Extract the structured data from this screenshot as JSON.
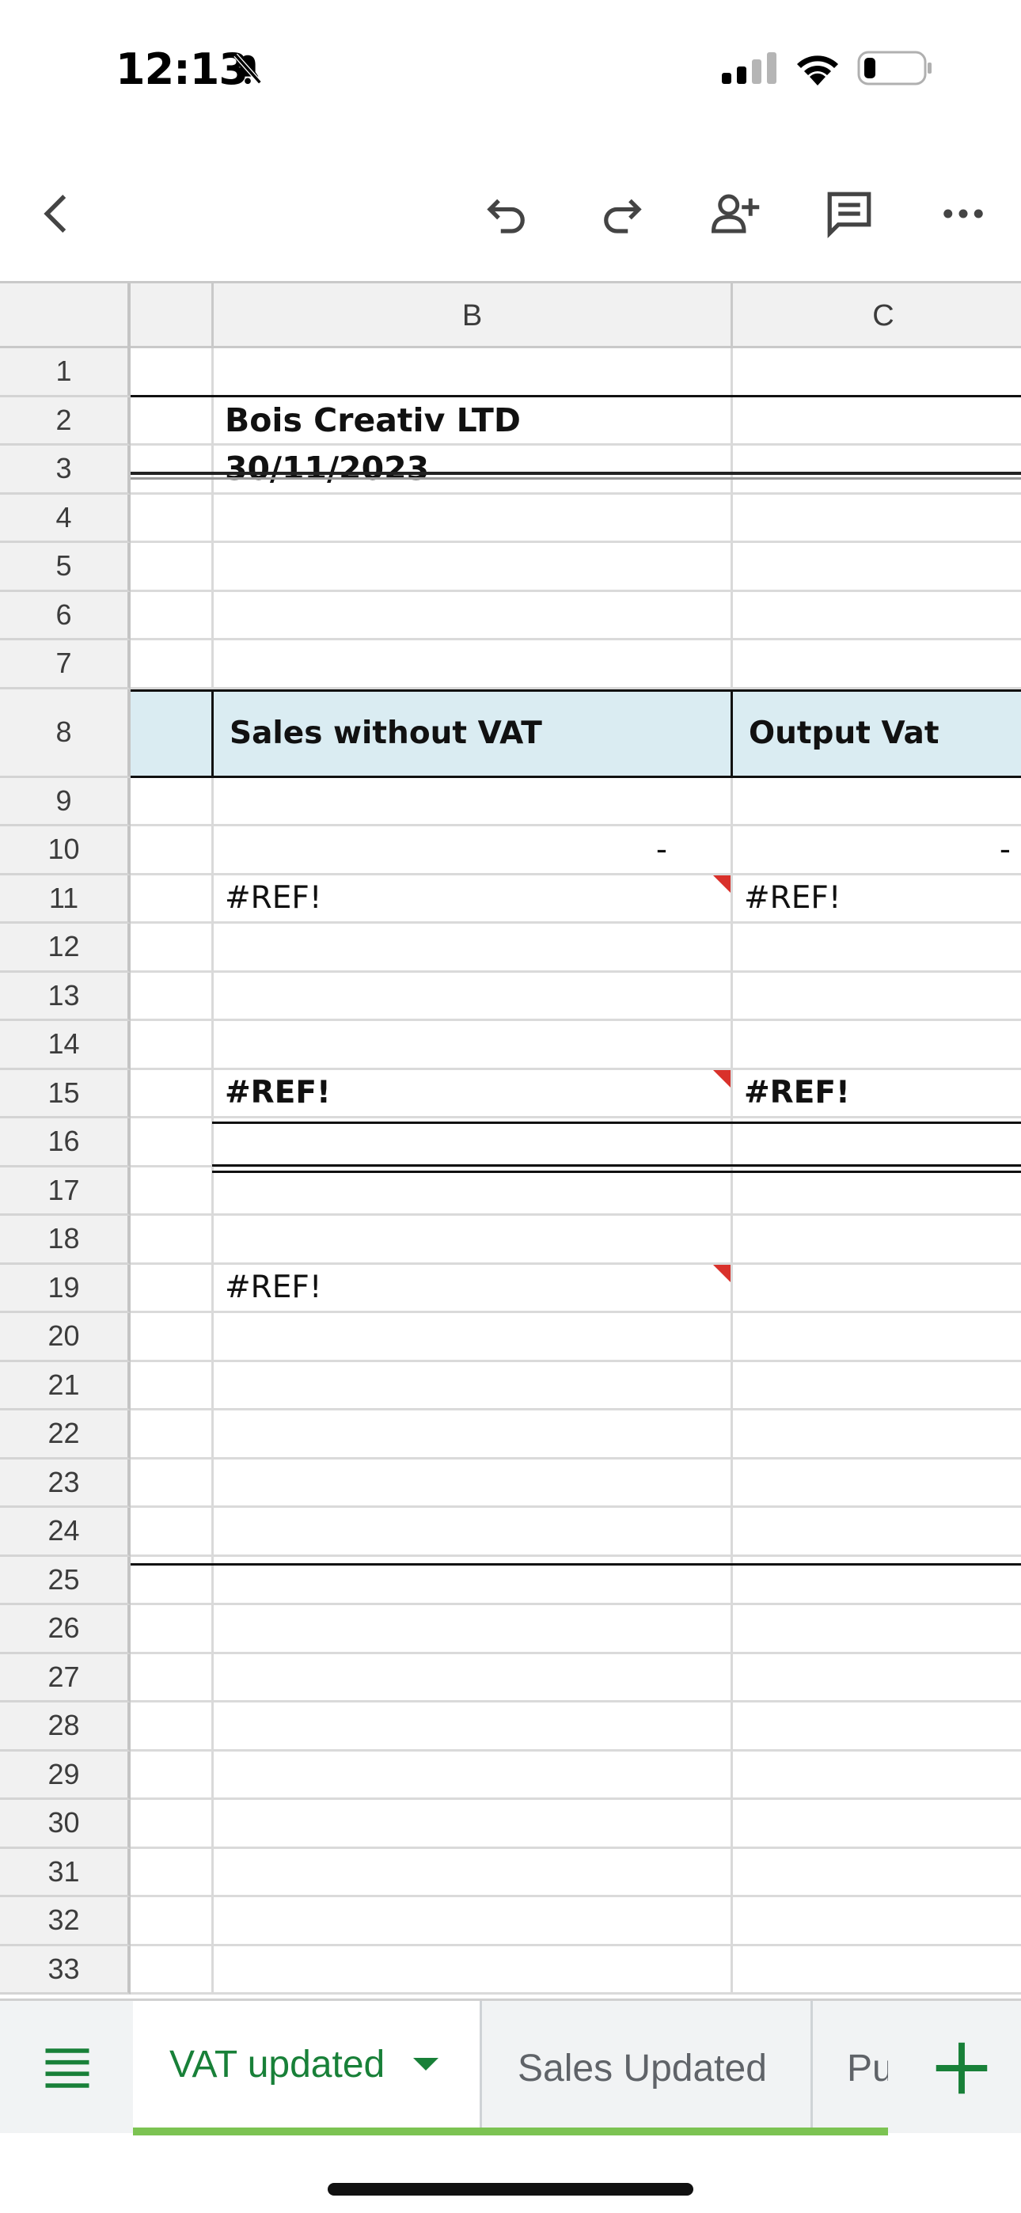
{
  "status_bar": {
    "time": "12:13"
  },
  "toolbar": {
    "buttons": [
      "back",
      "undo",
      "redo",
      "share",
      "comment",
      "more"
    ]
  },
  "sheet": {
    "columns": [
      "",
      "B",
      "C"
    ],
    "rows": [
      {
        "n": "1",
        "b": "",
        "c": ""
      },
      {
        "n": "2",
        "b": "Bois Creativ LTD",
        "c": ""
      },
      {
        "n": "3",
        "b": "30/11/2023",
        "c": ""
      },
      {
        "n": "4",
        "b": "",
        "c": ""
      },
      {
        "n": "5",
        "b": "",
        "c": ""
      },
      {
        "n": "6",
        "b": "",
        "c": ""
      },
      {
        "n": "7",
        "b": "",
        "c": ""
      },
      {
        "n": "8",
        "b": "Sales without VAT",
        "c": "Output Vat"
      },
      {
        "n": "9",
        "b": "",
        "c": ""
      },
      {
        "n": "10",
        "b": "-",
        "c": "-"
      },
      {
        "n": "11",
        "b": "#REF!",
        "c": "#REF!"
      },
      {
        "n": "12",
        "b": "",
        "c": ""
      },
      {
        "n": "13",
        "b": "",
        "c": ""
      },
      {
        "n": "14",
        "b": "",
        "c": ""
      },
      {
        "n": "15",
        "b": "#REF!",
        "c": "#REF!"
      },
      {
        "n": "16",
        "b": "",
        "c": ""
      },
      {
        "n": "17",
        "b": "",
        "c": ""
      },
      {
        "n": "18",
        "b": "",
        "c": ""
      },
      {
        "n": "19",
        "b": "#REF!",
        "c": ""
      },
      {
        "n": "20",
        "b": "",
        "c": ""
      },
      {
        "n": "21",
        "b": "",
        "c": ""
      },
      {
        "n": "22",
        "b": "",
        "c": ""
      },
      {
        "n": "23",
        "b": "",
        "c": ""
      },
      {
        "n": "24",
        "b": "",
        "c": ""
      },
      {
        "n": "25",
        "b": "",
        "c": ""
      },
      {
        "n": "26",
        "b": "",
        "c": ""
      },
      {
        "n": "27",
        "b": "",
        "c": ""
      },
      {
        "n": "28",
        "b": "",
        "c": ""
      },
      {
        "n": "29",
        "b": "",
        "c": ""
      },
      {
        "n": "30",
        "b": "",
        "c": ""
      },
      {
        "n": "31",
        "b": "",
        "c": ""
      },
      {
        "n": "32",
        "b": "",
        "c": ""
      },
      {
        "n": "33",
        "b": "",
        "c": ""
      }
    ]
  },
  "sheet_tabs": {
    "active": "VAT updated",
    "others": [
      "Sales Updated",
      "Pu"
    ]
  },
  "colors": {
    "accent_green": "#188038",
    "tab_underline": "#7cc352",
    "header_fill": "#daecf2",
    "note_red": "#d9312b"
  }
}
